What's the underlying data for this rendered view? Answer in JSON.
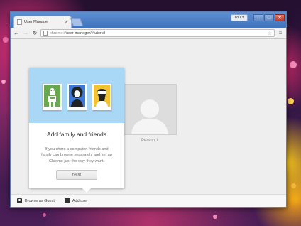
{
  "window": {
    "tab_title": "User Manager",
    "tab_close": "✕",
    "profile_badge": "You",
    "min_label": "–",
    "max_label": "□",
    "close_label": "✕"
  },
  "toolbar": {
    "back": "←",
    "forward": "→",
    "reload": "↻",
    "url_scheme": "chrome://",
    "url_path": "user-manager/#tutorial",
    "star": "☆",
    "menu": "≡"
  },
  "person": {
    "name": "Person 1"
  },
  "tutorial": {
    "title": "Add family and friends",
    "text": "If you share a computer, friends and family can browse separately and set up Chrome just the way they want.",
    "next_label": "Next",
    "avatar_colors": [
      "#6aa84f",
      "#3c78d8",
      "#f1c232"
    ]
  },
  "footer": {
    "guest_label": "Browse as Guest",
    "add_label": "Add user",
    "add_icon": "+"
  },
  "colors": {
    "title_bar": "#4f82c8",
    "tutorial_header": "#a9d8f6",
    "page_background": "#eeeeee"
  }
}
